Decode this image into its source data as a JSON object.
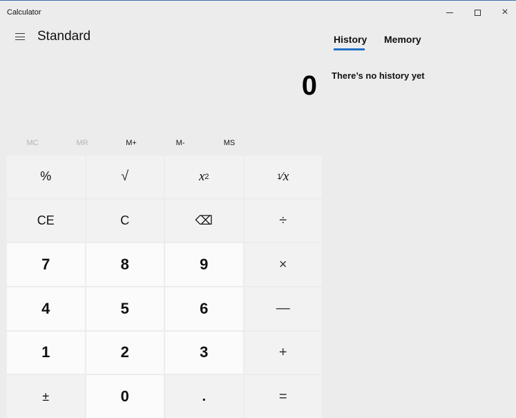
{
  "window": {
    "title": "Calculator",
    "controls": {
      "minimize": "minimize",
      "maximize": "maximize",
      "close": "×"
    }
  },
  "header": {
    "mode": "Standard"
  },
  "display": {
    "value": "0"
  },
  "memory": {
    "buttons": [
      {
        "label": "MC",
        "enabled": false
      },
      {
        "label": "MR",
        "enabled": false
      },
      {
        "label": "M+",
        "enabled": true
      },
      {
        "label": "M-",
        "enabled": true
      },
      {
        "label": "MS",
        "enabled": true
      }
    ]
  },
  "keypad": {
    "percent": "%",
    "sqrt": "√",
    "square_base": "x",
    "square_exp": "2",
    "reciprocal_num": "1",
    "reciprocal_den": "x",
    "ce": "CE",
    "c": "C",
    "backspace": "⌫",
    "divide": "÷",
    "seven": "7",
    "eight": "8",
    "nine": "9",
    "multiply": "×",
    "four": "4",
    "five": "5",
    "six": "6",
    "minus": "—",
    "one": "1",
    "two": "2",
    "three": "3",
    "plus": "+",
    "negate": "±",
    "zero": "0",
    "decimal": ".",
    "equals": "="
  },
  "side_panel": {
    "tabs": [
      {
        "label": "History"
      },
      {
        "label": "Memory"
      }
    ],
    "active_tab": "History",
    "empty_message": "There’s no history yet"
  }
}
